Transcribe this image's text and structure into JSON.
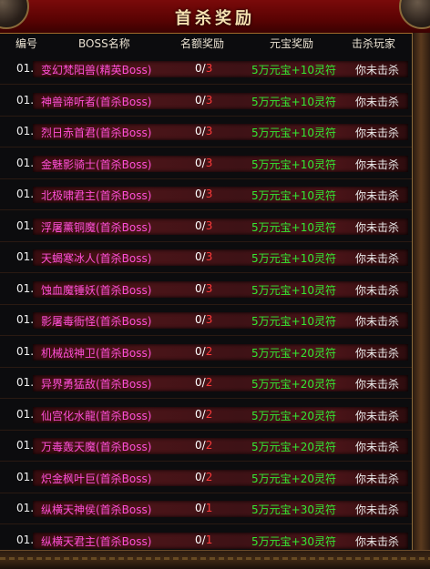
{
  "window": {
    "title": "首杀奖励"
  },
  "header": {
    "col_index": "编号",
    "col_name": "BOSS名称",
    "col_quota": "名额奖励",
    "col_reward": "元宝奖励",
    "col_killer": "击杀玩家"
  },
  "colors": {
    "boss_name": "#ff4fd8",
    "reward": "#33e833",
    "quota_remaining": "#ff3a3a",
    "title_bar": "#6a0505"
  },
  "rows": [
    {
      "index": "01.",
      "name": "变幻梵阳兽(精英Boss)",
      "claimed": "0",
      "total": "3",
      "reward": "5万元宝+10灵符",
      "killer": "你未击杀"
    },
    {
      "index": "01.",
      "name": "神兽谛听者(首杀Boss)",
      "claimed": "0",
      "total": "3",
      "reward": "5万元宝+10灵符",
      "killer": "你未击杀"
    },
    {
      "index": "01.",
      "name": "烈日赤首君(首杀Boss)",
      "claimed": "0",
      "total": "3",
      "reward": "5万元宝+10灵符",
      "killer": "你未击杀"
    },
    {
      "index": "01.",
      "name": "金魅影骑士(首杀Boss)",
      "claimed": "0",
      "total": "3",
      "reward": "5万元宝+10灵符",
      "killer": "你未击杀"
    },
    {
      "index": "01.",
      "name": "北极啸君主(首杀Boss)",
      "claimed": "0",
      "total": "3",
      "reward": "5万元宝+10灵符",
      "killer": "你未击杀"
    },
    {
      "index": "01.",
      "name": "浮屠薰铜魔(首杀Boss)",
      "claimed": "0",
      "total": "3",
      "reward": "5万元宝+10灵符",
      "killer": "你未击杀"
    },
    {
      "index": "01.",
      "name": "天蝎寒冰人(首杀Boss)",
      "claimed": "0",
      "total": "3",
      "reward": "5万元宝+10灵符",
      "killer": "你未击杀"
    },
    {
      "index": "01.",
      "name": "蚀血魔锤妖(首杀Boss)",
      "claimed": "0",
      "total": "3",
      "reward": "5万元宝+10灵符",
      "killer": "你未击杀"
    },
    {
      "index": "01.",
      "name": "影屠毒衙怪(首杀Boss)",
      "claimed": "0",
      "total": "3",
      "reward": "5万元宝+10灵符",
      "killer": "你未击杀"
    },
    {
      "index": "01.",
      "name": "机械战神卫(首杀Boss)",
      "claimed": "0",
      "total": "2",
      "reward": "5万元宝+20灵符",
      "killer": "你未击杀"
    },
    {
      "index": "01.",
      "name": "异界勇猛敌(首杀Boss)",
      "claimed": "0",
      "total": "2",
      "reward": "5万元宝+20灵符",
      "killer": "你未击杀"
    },
    {
      "index": "01.",
      "name": "仙宫化水龍(首杀Boss)",
      "claimed": "0",
      "total": "2",
      "reward": "5万元宝+20灵符",
      "killer": "你未击杀"
    },
    {
      "index": "01.",
      "name": "万毒轰天魔(首杀Boss)",
      "claimed": "0",
      "total": "2",
      "reward": "5万元宝+20灵符",
      "killer": "你未击杀"
    },
    {
      "index": "01.",
      "name": "炽金枫叶巨(首杀Boss)",
      "claimed": "0",
      "total": "2",
      "reward": "5万元宝+20灵符",
      "killer": "你未击杀"
    },
    {
      "index": "01.",
      "name": "纵横天神侯(首杀Boss)",
      "claimed": "0",
      "total": "1",
      "reward": "5万元宝+30灵符",
      "killer": "你未击杀"
    },
    {
      "index": "01.",
      "name": "纵横天君主(首杀Boss)",
      "claimed": "0",
      "total": "1",
      "reward": "5万元宝+30灵符",
      "killer": "你未击杀"
    }
  ]
}
